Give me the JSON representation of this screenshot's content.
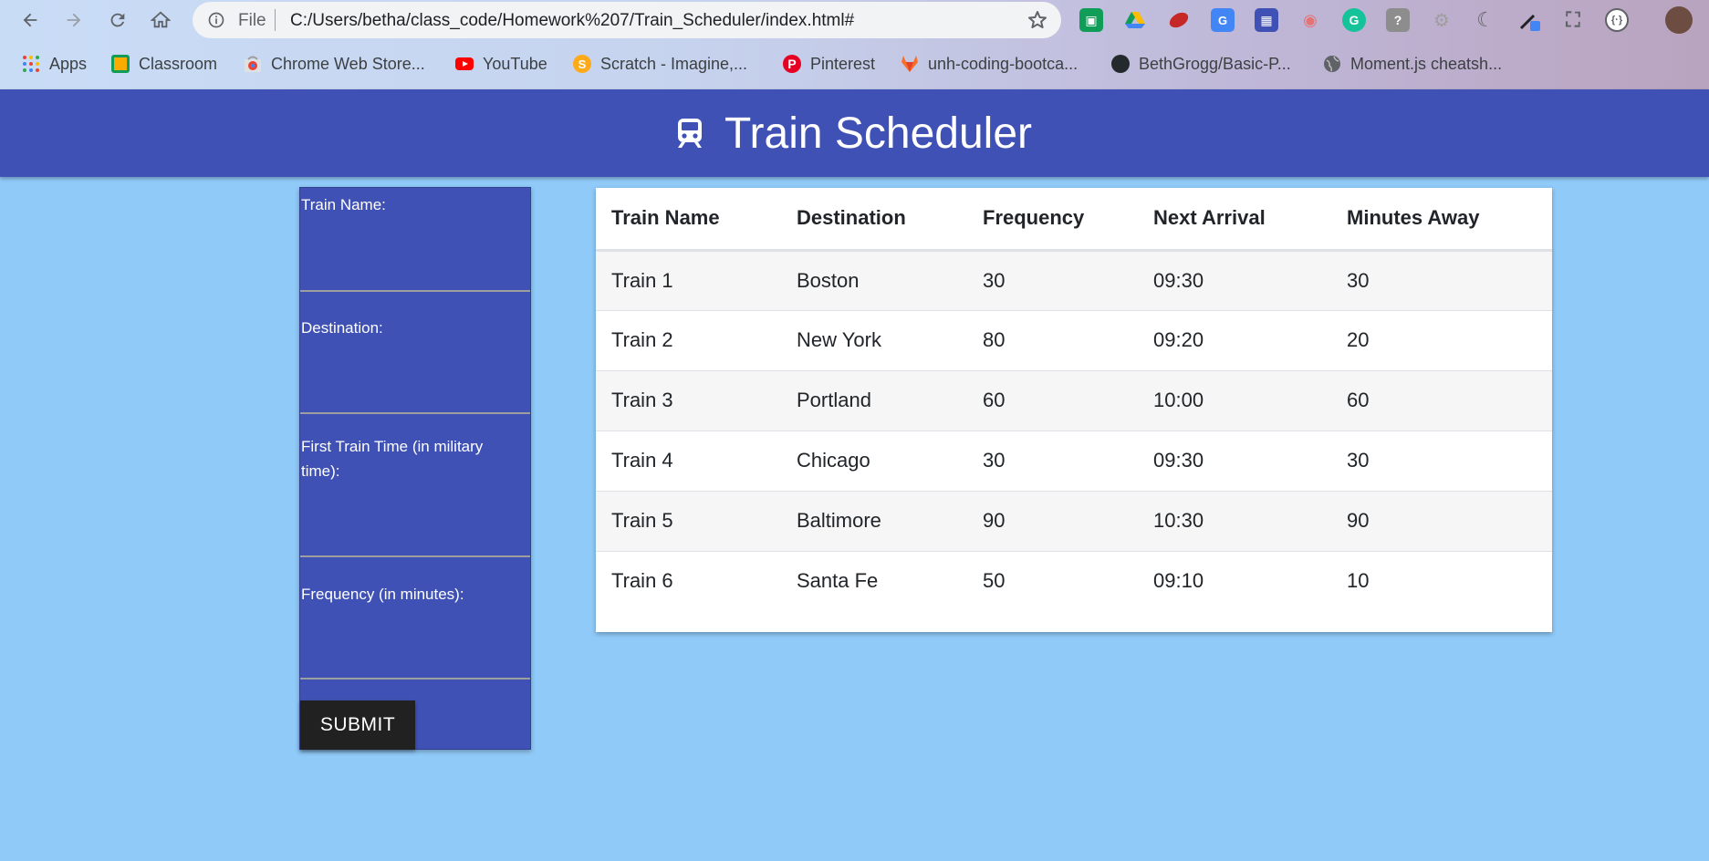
{
  "browser": {
    "scheme_label": "File",
    "url": "C:/Users/betha/class_code/Homework%207/Train_Scheduler/index.html#",
    "bookmarks": [
      {
        "label": "Apps",
        "icon": "apps-grid-icon"
      },
      {
        "label": "Classroom",
        "icon": "classroom-icon"
      },
      {
        "label": "Chrome Web Store...",
        "icon": "chrome-web-store-icon"
      },
      {
        "label": "YouTube",
        "icon": "youtube-icon"
      },
      {
        "label": "Scratch - Imagine,...",
        "icon": "scratch-icon"
      },
      {
        "label": "Pinterest",
        "icon": "pinterest-icon"
      },
      {
        "label": "unh-coding-bootca...",
        "icon": "gitlab-icon"
      },
      {
        "label": "BethGrogg/Basic-P...",
        "icon": "github-icon"
      },
      {
        "label": "Moment.js cheatsh...",
        "icon": "globe-icon"
      }
    ]
  },
  "page": {
    "title": "Train Scheduler",
    "form": {
      "fields": [
        {
          "label": "Train Name:"
        },
        {
          "label": "Destination:"
        },
        {
          "label": "First Train Time (in military time):"
        },
        {
          "label": "Frequency (in minutes):"
        }
      ],
      "submit_label": "SUBMIT"
    },
    "table": {
      "headers": [
        "Train Name",
        "Destination",
        "Frequency",
        "Next Arrival",
        "Minutes Away"
      ],
      "rows": [
        [
          "Train 1",
          "Boston",
          "30",
          "09:30",
          "30"
        ],
        [
          "Train 2",
          "New York",
          "80",
          "09:20",
          "20"
        ],
        [
          "Train 3",
          "Portland",
          "60",
          "10:00",
          "60"
        ],
        [
          "Train 4",
          "Chicago",
          "30",
          "09:30",
          "30"
        ],
        [
          "Train 5",
          "Baltimore",
          "90",
          "10:30",
          "90"
        ],
        [
          "Train 6",
          "Santa Fe",
          "50",
          "09:10",
          "10"
        ]
      ]
    }
  },
  "colors": {
    "header": "#3f51b5",
    "background": "#90caf9",
    "submit": "#212121"
  }
}
